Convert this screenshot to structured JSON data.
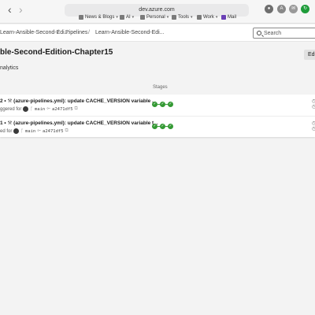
{
  "browser": {
    "url": "dev.azure.com",
    "favorites": [
      {
        "label": "News & Blogs",
        "color": "#7a7a7a"
      },
      {
        "label": "AI",
        "color": "#7a7a7a"
      },
      {
        "label": "Personal",
        "color": "#7a7a7a"
      },
      {
        "label": "Tools",
        "color": "#7a7a7a"
      },
      {
        "label": "Work",
        "color": "#7a7a7a"
      },
      {
        "label": "Mail",
        "color": "#6a3fb5"
      }
    ]
  },
  "header": {
    "breadcrumbs": [
      "Learn-Ansible-Second-Edi...",
      "Pipelines",
      "Learn-Ansible-Second-Edi..."
    ],
    "search_placeholder": "Search"
  },
  "page": {
    "title": "ble-Second-Edition-Chapter15",
    "edit_label": "Edi",
    "analytics_label": "nalytics",
    "stages_header": "Stages"
  },
  "runs": [
    {
      "title_prefix": "2 •",
      "title": "(azure-pipelines.yml): update CACHE_VERSION variable ...",
      "trigger": "ggered for",
      "branch": "main",
      "commit": "a2471df5",
      "status_color": "#339933",
      "stages": 3
    },
    {
      "title_prefix": "1 •",
      "title": "(azure-pipelines.yml): update CACHE_VERSION variable t...",
      "trigger": "ed for",
      "branch": "main",
      "commit": "a2471df5",
      "status_color": "#339933",
      "stages": 3
    }
  ]
}
